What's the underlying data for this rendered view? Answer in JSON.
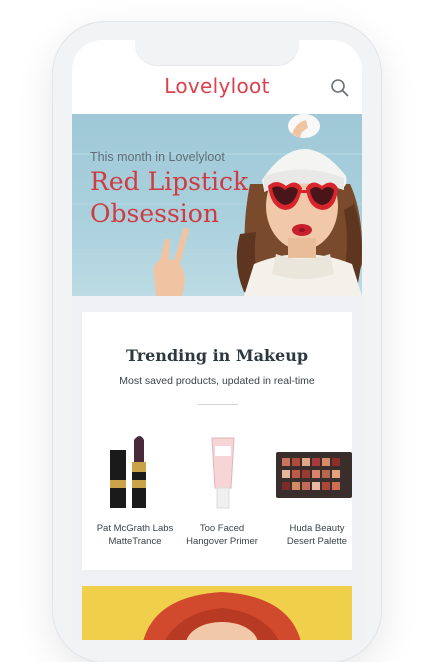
{
  "app": {
    "logo": "Lovelyloot"
  },
  "hero": {
    "subtitle": "This month in Lovelyloot",
    "title": "Red Lipstick Obsession"
  },
  "trending": {
    "title": "Trending in Makeup",
    "subtitle": "Most saved products, updated in real-time",
    "products": [
      {
        "line1": "Pat McGrath Labs",
        "line2": "MatteTrance"
      },
      {
        "line1": "Too Faced",
        "line2": "Hangover Primer"
      },
      {
        "line1": "Huda Beauty",
        "line2": "Desert Palette"
      }
    ]
  },
  "colors": {
    "brand": "#d9424c",
    "hero_bg": "#a9d0dc",
    "promo_bg": "#f0cf4b"
  },
  "icons": {
    "search": "search-icon"
  }
}
